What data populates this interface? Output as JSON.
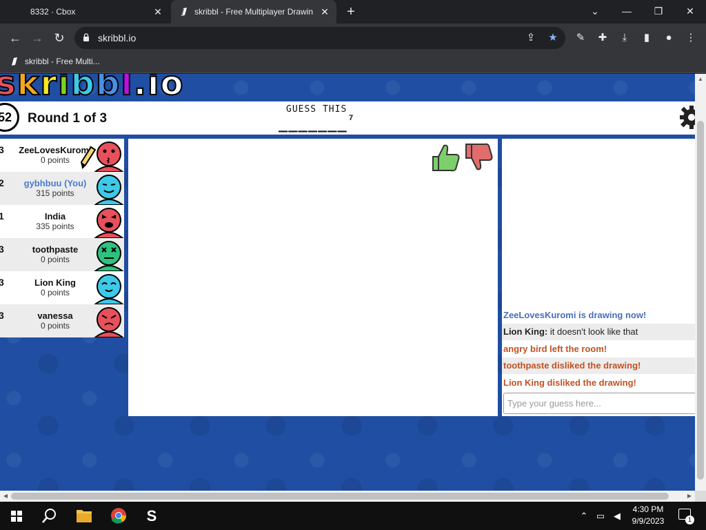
{
  "browser": {
    "tabs": [
      {
        "title": "8332 · Cbox",
        "active": false
      },
      {
        "title": "skribbl - Free Multiplayer Drawin",
        "active": true
      }
    ],
    "url": "skribbl.io",
    "bookmarks": [
      {
        "label": "skribbl - Free Multi..."
      }
    ]
  },
  "game": {
    "logo_text": "skribbl.io",
    "timer": "52",
    "round_label": "Round 1 of 3",
    "guess_label": "GUESS THIS",
    "hint": "_______",
    "hint_letter_count": "7",
    "players": [
      {
        "rank": "3",
        "name": "ZeeLovesKuromi",
        "points": "0 points",
        "is_you": false,
        "drawing": true,
        "color": "#e8505b"
      },
      {
        "rank": "2",
        "name": "gybhbuu (You)",
        "points": "315 points",
        "is_you": true,
        "drawing": false,
        "color": "#3ec9e8"
      },
      {
        "rank": "1",
        "name": "India",
        "points": "335 points",
        "is_you": false,
        "drawing": false,
        "color": "#e8505b"
      },
      {
        "rank": "3",
        "name": "toothpaste",
        "points": "0 points",
        "is_you": false,
        "drawing": false,
        "color": "#2ec27e"
      },
      {
        "rank": "3",
        "name": "Lion King",
        "points": "0 points",
        "is_you": false,
        "drawing": false,
        "color": "#3ec9e8"
      },
      {
        "rank": "3",
        "name": "vanessa",
        "points": "0 points",
        "is_you": false,
        "drawing": false,
        "color": "#e8505b"
      }
    ],
    "chat": [
      {
        "text": "ZeeLovesKuromi is drawing now!",
        "type": "system-blue"
      },
      {
        "author": "Lion King:",
        "text": " it doesn't look like that",
        "type": "message"
      },
      {
        "text": "angry bird left the room!",
        "type": "system-red"
      },
      {
        "text": "toothpaste disliked the drawing!",
        "type": "system-red"
      },
      {
        "text": "Lion King disliked the drawing!",
        "type": "system-red"
      }
    ],
    "chat_placeholder": "Type your guess here..."
  },
  "taskbar": {
    "time": "4:30 PM",
    "date": "9/9/2023",
    "notification_count": "1"
  },
  "colors": {
    "page_bg": "#1f4ea3",
    "system_blue": "#4a6fb5",
    "system_red": "#c25121",
    "you_blue": "#4a7bd0"
  }
}
